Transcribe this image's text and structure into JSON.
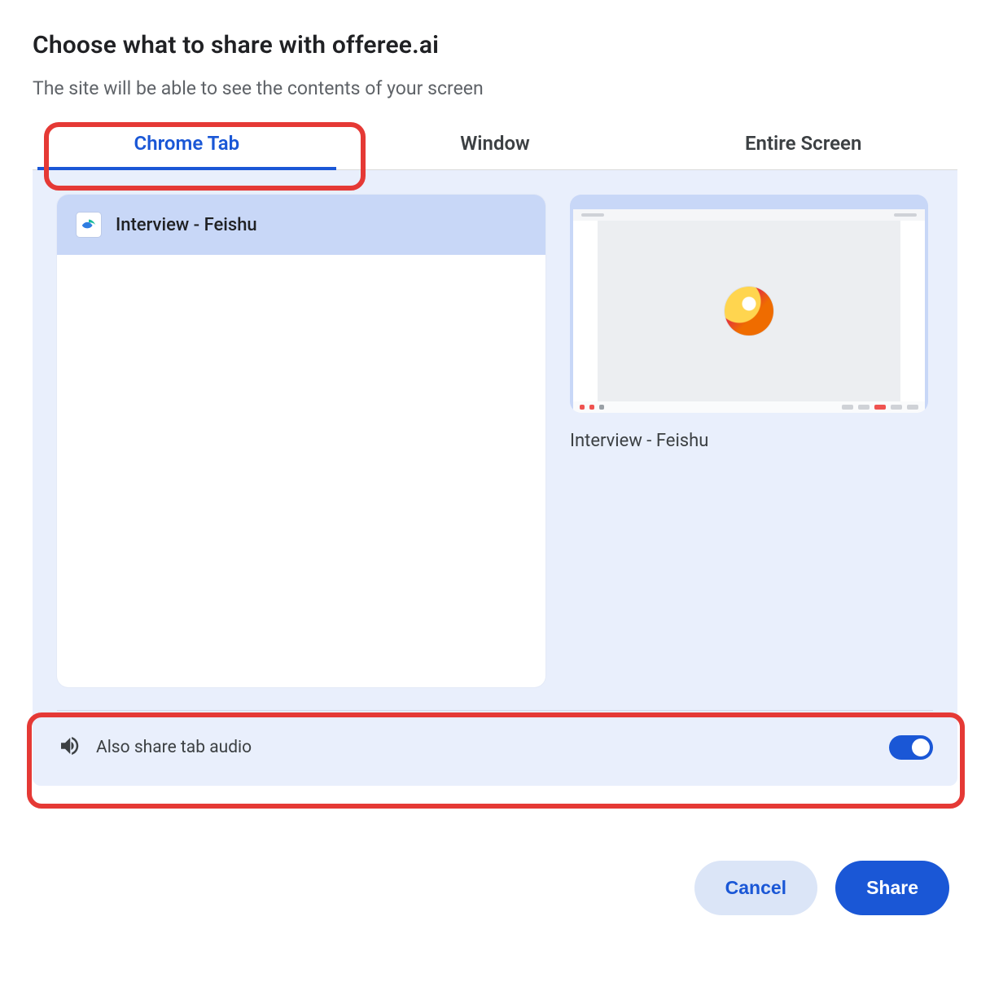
{
  "dialog": {
    "title": "Choose what to share with offeree.ai",
    "subtitle": "The site will be able to see the contents of your screen"
  },
  "tabs": [
    {
      "label": "Chrome Tab",
      "active": true
    },
    {
      "label": "Window",
      "active": false
    },
    {
      "label": "Entire Screen",
      "active": false
    }
  ],
  "tab_list": {
    "items": [
      {
        "title": "Interview - Feishu",
        "icon": "feishu-icon"
      }
    ]
  },
  "preview": {
    "caption": "Interview - Feishu"
  },
  "audio": {
    "label": "Also share tab audio",
    "enabled": true
  },
  "footer": {
    "cancel": "Cancel",
    "share": "Share"
  },
  "highlights": {
    "tab_highlighted": true,
    "audio_highlighted": true
  }
}
